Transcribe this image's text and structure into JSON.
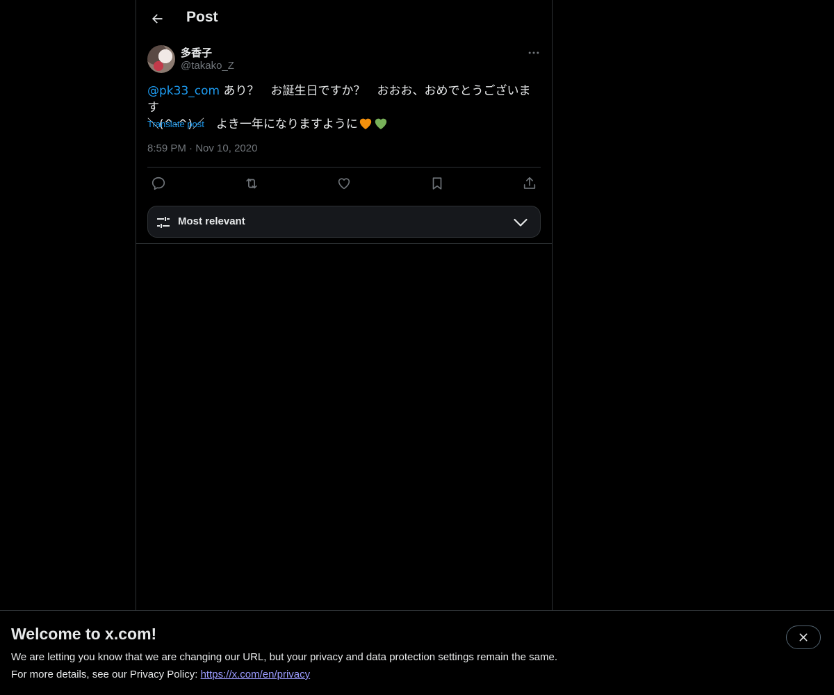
{
  "header": {
    "title": "Post",
    "back_icon": "arrow-left-icon"
  },
  "post": {
    "author_name": "多香子",
    "author_handle": "@takako_Z",
    "mention": "@pk33_com",
    "text_line1": " あり？　お誕生日ですか？　おおお、おめでとうございます",
    "text_line2": "＼(^-^)／　よき一年になりますように",
    "emoji_1": "orange-heart-icon",
    "emoji_2": "green-heart-icon",
    "translate_label": "Translate post",
    "time": "8:59 PM",
    "separator": "·",
    "date": "Nov 10, 2020"
  },
  "actions": [
    "reply-icon",
    "repost-icon",
    "like-icon",
    "bookmark-icon",
    "share-icon"
  ],
  "sort": {
    "label": "Most relevant"
  },
  "banner": {
    "title": "Welcome to x.com!",
    "line1": "We are letting you know that we are changing our URL, but your privacy and data protection settings remain the same.",
    "line2_prefix": "For more details, see our Privacy Policy: ",
    "link": "https://x.com/en/privacy"
  },
  "colors": {
    "accent": "#1d9bf0",
    "background": "#000000",
    "text": "#e7e9ea",
    "muted": "#71767b",
    "border": "#2f3336",
    "heart_orange": "#f4900c",
    "heart_green": "#78b159"
  }
}
